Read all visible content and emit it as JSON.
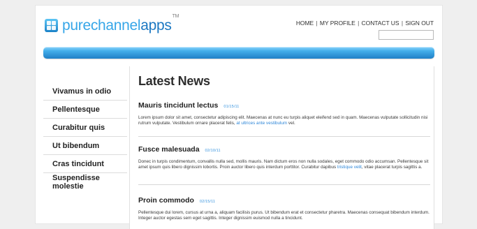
{
  "brand": {
    "name_part1": "purechannel",
    "name_part2": "apps",
    "mark": "TM"
  },
  "header": {
    "nav_links": [
      "HOME",
      "MY PROFILE",
      "CONTACT US",
      "SIGN OUT"
    ],
    "nav_separator": "|",
    "search": {
      "value": "",
      "placeholder": ""
    }
  },
  "colors": {
    "page_background": "#efefef",
    "brand_light_blue": "#36a6e8",
    "brand_dark_blue": "#1c78c2",
    "bar_blue": "#1f7fc6",
    "date_blue": "#3a95df"
  },
  "sidebar": {
    "items": [
      {
        "label": "Vivamus in odio"
      },
      {
        "label": "Pellentesque"
      },
      {
        "label": "Curabitur quis"
      },
      {
        "label": "Ut bibendum"
      },
      {
        "label": "Cras tincidunt"
      },
      {
        "label": "Suspendisse molestie"
      }
    ]
  },
  "main": {
    "title": "Latest News",
    "news": [
      {
        "title": "Mauris tincidunt lectus",
        "date": "01/15/11",
        "body_before_link": "Lorem ipsum dolor sit amet, consectetur adipiscing elit. Maecenas at nunc eu turpis aliquet eleifend sed in quam. Maecenas vulputate sollicitudin nisi rutrum vulputate. Vestibulum ornare placerat felis, ",
        "body_link": "at ultrices ante vestibulum",
        "body_after_link": " vel."
      },
      {
        "title": "Fusce malesuada",
        "date": "02/10/11",
        "body_before_link": "Donec in turpis condimentum, convallis nulla sed, mollis mauris. Nam dictum eros non nulla sodales, eget commodo odio accumsan. Pellentesque sit amet ipsum quis libero dignissim lobortis. Proin auctor libero quis interdum porttitor. Curabitur dapibus ",
        "body_link": "tristique velit",
        "body_after_link": ", vitae placerat turpis sagittis a."
      },
      {
        "title": "Proin commodo",
        "date": "02/15/11",
        "body_before_link": "Pellentesque dui lorem, cursus at urna a, aliquam facilisis purus. Ut bibendum erat et consectetur pharetra. Maecenas consequat bibendum interdum. Integer auctor egestas sem eget sagittis. Integer dignissim euismod nulla a tincidunt.",
        "body_link": "",
        "body_after_link": ""
      }
    ]
  }
}
